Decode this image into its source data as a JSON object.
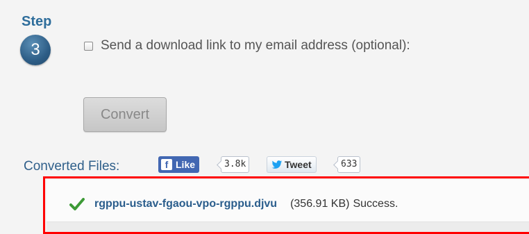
{
  "step": {
    "label": "Step",
    "number": "3"
  },
  "email_option": {
    "label": "Send a download link to my email address (optional):",
    "checked": false
  },
  "convert_button": {
    "label": "Convert",
    "enabled": false
  },
  "converted_files": {
    "label": "Converted Files:",
    "social": {
      "like_label": "Like",
      "like_count": "3.8k",
      "tweet_label": "Tweet",
      "tweet_count": "633"
    },
    "files": [
      {
        "name": "rgppu-ustav-fgaou-vpo-rgppu.djvu",
        "size": "(356.91 KB)",
        "status": "Success."
      }
    ]
  },
  "colors": {
    "accent": "#2e6d9b",
    "link": "#2a5d8c",
    "success": "#3d9a36",
    "facebook": "#4267b2",
    "twitter": "#1da1f2",
    "highlight_border": "#ff0000"
  }
}
